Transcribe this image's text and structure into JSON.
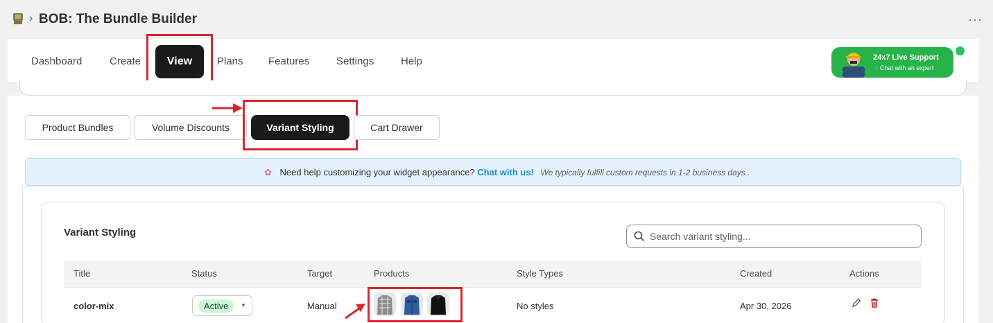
{
  "app": {
    "title": "BOB: The Bundle Builder",
    "breadcrumb_separator": "›",
    "more_label": "···"
  },
  "nav": {
    "items": [
      "Dashboard",
      "Create",
      "View",
      "Plans",
      "Features",
      "Settings",
      "Help"
    ],
    "active": "View"
  },
  "support": {
    "title": "24x7 Live Support",
    "subtitle": "Chat with an expert"
  },
  "tabs": {
    "items": [
      "Product Bundles",
      "Volume Discounts",
      "Variant Styling",
      "Cart Drawer"
    ],
    "active": "Variant Styling"
  },
  "banner": {
    "question": "Need help customizing your widget appearance?",
    "link": "Chat with us!",
    "note": "We typically fulfill custom requests in 1-2 business days.."
  },
  "section": {
    "title": "Variant Styling",
    "search_placeholder": "Search variant styling..."
  },
  "table": {
    "headers": [
      "Title",
      "Status",
      "Target",
      "Products",
      "Style Types",
      "Created",
      "Actions"
    ],
    "rows": [
      {
        "title": "color-mix",
        "status": "Active",
        "target": "Manual",
        "products": [
          "plaid-shirt",
          "denim-shirt",
          "black-shirt"
        ],
        "style_types": "No styles",
        "created": "Apr 30, 2026"
      }
    ]
  },
  "colors": {
    "accent_dark": "#1a1a1a",
    "highlight_red": "#d9262c",
    "support_green": "#27b34a",
    "active_badge": "#cdf5d5",
    "link_blue": "#1d8fc7"
  }
}
